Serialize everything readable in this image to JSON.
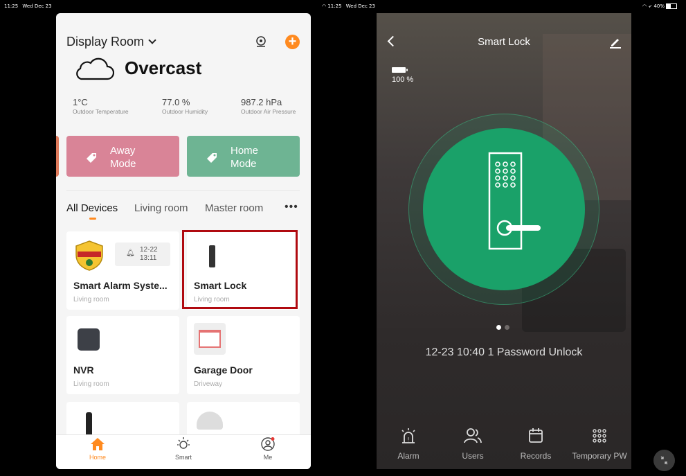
{
  "status_left": {
    "time": "11:25",
    "date": "Wed Dec 23"
  },
  "status_mid": {
    "time": "11:25",
    "date": "Wed Dec 23"
  },
  "status_right": {
    "battery": "40%"
  },
  "left_app": {
    "header": {
      "title": "Display Room"
    },
    "weather": {
      "condition": "Overcast"
    },
    "stats": [
      {
        "value": "1°C",
        "label": "Outdoor Temperature"
      },
      {
        "value": "77.0 %",
        "label": "Outdoor Humidity"
      },
      {
        "value": "987.2 hPa",
        "label": "Outdoor Air Pressure"
      }
    ],
    "modes": [
      {
        "label": "Away Mode",
        "color": "#d98497"
      },
      {
        "label": "Home Mode",
        "color": "#6eb493"
      }
    ],
    "tabs": [
      "All Devices",
      "Living room",
      "Master room"
    ],
    "devices": [
      {
        "name": "Smart Alarm Syste...",
        "room": "Living room",
        "badge_date": "12-22",
        "badge_time": "13:11"
      },
      {
        "name": "Smart Lock",
        "room": "Living room"
      },
      {
        "name": "NVR",
        "room": "Living room"
      },
      {
        "name": "Garage Door",
        "room": "Driveway"
      }
    ],
    "nav": [
      "Home",
      "Smart",
      "Me"
    ],
    "accent": "#ff8a1f"
  },
  "right_app": {
    "title": "Smart Lock",
    "battery": "100 %",
    "last_event": "12-23 10:40  1 Password Unlock",
    "nav": [
      "Alarm",
      "Users",
      "Records",
      "Temporary PW"
    ],
    "lock_color": "#1aa169"
  }
}
